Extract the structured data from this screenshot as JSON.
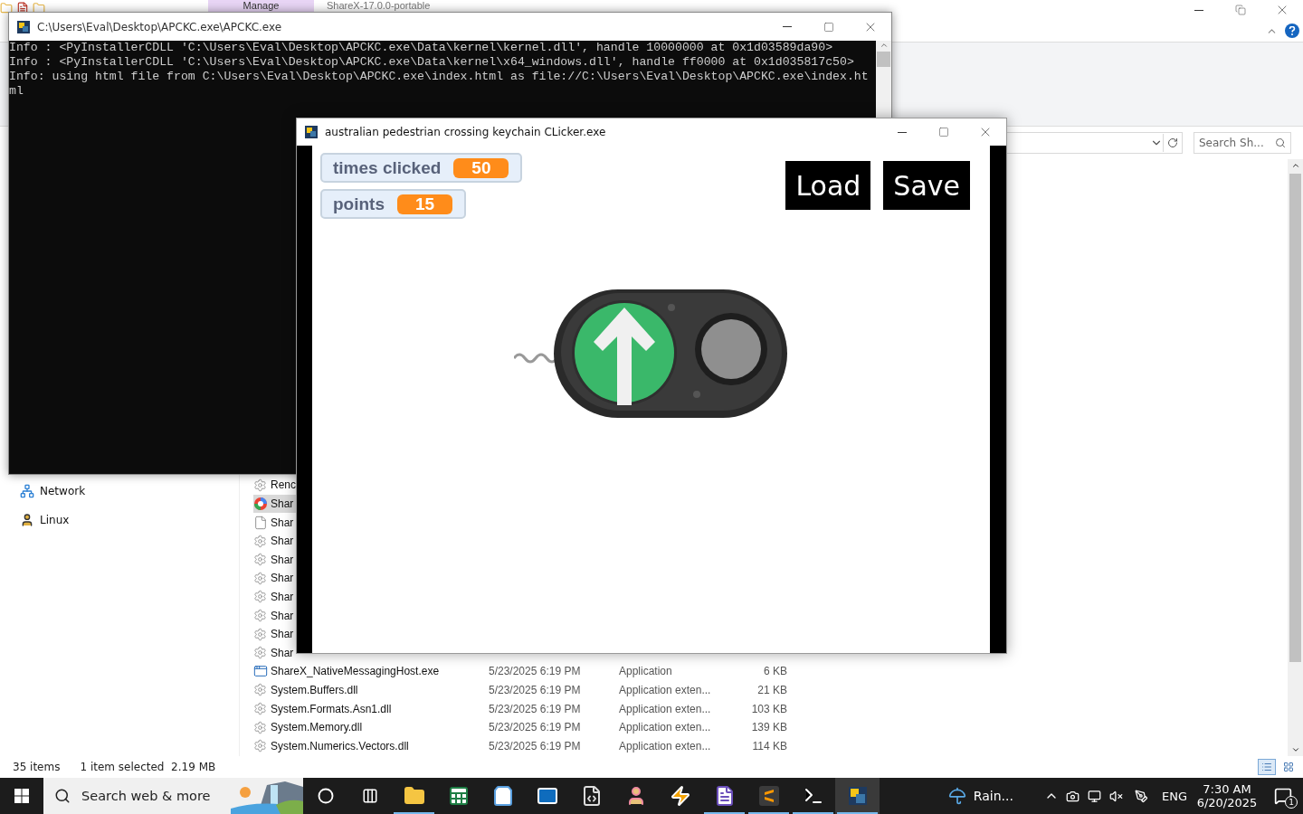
{
  "explorer": {
    "ribbon_tab": "Manage",
    "title": "ShareX-17.0.0-portable",
    "search": {
      "placeholder": "Search Sh..."
    },
    "nav_items": [
      {
        "label": "Network",
        "kind": "network"
      },
      {
        "label": "Linux",
        "kind": "linux"
      }
    ],
    "files": [
      {
        "name": "Renc",
        "kind": "dll",
        "selected": false
      },
      {
        "name": "Shar",
        "kind": "app",
        "selected": true
      },
      {
        "name": "Shar",
        "kind": "blank",
        "selected": false
      },
      {
        "name": "Shar",
        "kind": "dll",
        "selected": false
      },
      {
        "name": "Shar",
        "kind": "dll",
        "selected": false
      },
      {
        "name": "Shar",
        "kind": "dll",
        "selected": false
      },
      {
        "name": "Shar",
        "kind": "dll",
        "selected": false
      },
      {
        "name": "Shar",
        "kind": "dll",
        "selected": false
      },
      {
        "name": "Shar",
        "kind": "dll",
        "selected": false
      },
      {
        "name": "Shar",
        "kind": "dll",
        "selected": false
      },
      {
        "name": "ShareX_NativeMessagingHost.exe",
        "kind": "exe",
        "selected": false,
        "date": "5/23/2025 6:19 PM",
        "type": "Application",
        "size": "6 KB"
      },
      {
        "name": "System.Buffers.dll",
        "kind": "dll",
        "selected": false,
        "date": "5/23/2025 6:19 PM",
        "type": "Application exten...",
        "size": "21 KB"
      },
      {
        "name": "System.Formats.Asn1.dll",
        "kind": "dll",
        "selected": false,
        "date": "5/23/2025 6:19 PM",
        "type": "Application exten...",
        "size": "103 KB"
      },
      {
        "name": "System.Memory.dll",
        "kind": "dll",
        "selected": false,
        "date": "5/23/2025 6:19 PM",
        "type": "Application exten...",
        "size": "139 KB"
      },
      {
        "name": "System.Numerics.Vectors.dll",
        "kind": "dll",
        "selected": false,
        "date": "5/23/2025 6:19 PM",
        "type": "Application exten...",
        "size": "114 KB"
      }
    ],
    "status": {
      "count": "35 items",
      "selection": "1 item selected  2.19 MB"
    },
    "views": [
      {
        "kind": "details",
        "selected": true
      },
      {
        "kind": "tiles",
        "selected": false
      }
    ]
  },
  "console": {
    "title": "C:\\Users\\Eval\\Desktop\\APCKC.exe\\APCKC.exe",
    "lines": [
      "Info : <PyInstallerCDLL 'C:\\Users\\Eval\\Desktop\\APCKC.exe\\Data\\kernel\\kernel.dll', handle 10000000 at 0x1d03589da90>",
      "Info : <PyInstallerCDLL 'C:\\Users\\Eval\\Desktop\\APCKC.exe\\Data\\kernel\\x64_windows.dll', handle ff0000 at 0x1d035817c50>",
      "Info: using html file from C:\\Users\\Eval\\Desktop\\APCKC.exe\\index.html as file://C:\\Users\\Eval\\Desktop\\APCKC.exe\\index.ht",
      "ml"
    ]
  },
  "app": {
    "title": "australian pedestrian crossing keychain CLicker.exe",
    "stats": [
      {
        "label": "times clicked",
        "value": "50"
      },
      {
        "label": "points",
        "value": "15"
      }
    ],
    "buttons": [
      "Load",
      "Save"
    ]
  },
  "taskbar": {
    "search": {
      "placeholder": "Search web & more"
    },
    "apps": [
      {
        "kind": "cortana",
        "running": false,
        "selected": false
      },
      {
        "kind": "taskview",
        "running": false,
        "selected": false
      },
      {
        "kind": "folder",
        "running": true,
        "selected": false
      },
      {
        "kind": "sheet",
        "running": false,
        "selected": false
      },
      {
        "kind": "store",
        "running": false,
        "selected": false
      },
      {
        "kind": "mail",
        "running": false,
        "selected": false
      },
      {
        "kind": "pyfile",
        "running": false,
        "selected": false
      },
      {
        "kind": "figure",
        "running": false,
        "selected": false
      },
      {
        "kind": "bolt",
        "running": false,
        "selected": false
      },
      {
        "kind": "doc",
        "running": true,
        "selected": false
      },
      {
        "kind": "sublime",
        "running": true,
        "selected": false
      },
      {
        "kind": "terminal",
        "running": true,
        "selected": false
      },
      {
        "kind": "python",
        "running": true,
        "selected": true
      }
    ],
    "weather": "Rain...",
    "language": "ENG",
    "time": "7:30 AM",
    "date": "6/20/2025",
    "notifications": "1"
  }
}
